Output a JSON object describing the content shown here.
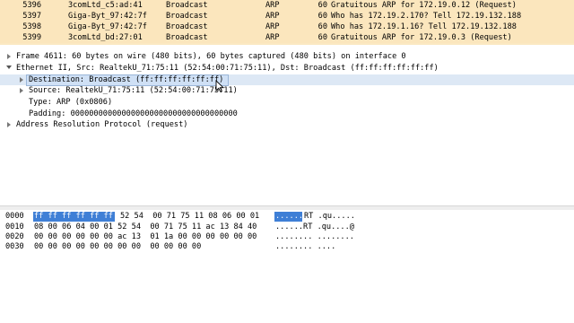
{
  "packets": [
    {
      "no": "5396",
      "src": "3comLtd_c5:ad:41",
      "dst": "Broadcast",
      "proto": "ARP",
      "len": "60",
      "info": "Gratuitous ARP for 172.19.0.12 (Request)"
    },
    {
      "no": "5397",
      "src": "Giga-Byt_97:42:7f",
      "dst": "Broadcast",
      "proto": "ARP",
      "len": "60",
      "info": "Who has 172.19.2.170? Tell 172.19.132.188"
    },
    {
      "no": "5398",
      "src": "Giga-Byt_97:42:7f",
      "dst": "Broadcast",
      "proto": "ARP",
      "len": "60",
      "info": "Who has 172.19.1.16? Tell 172.19.132.188"
    },
    {
      "no": "5399",
      "src": "3comLtd_bd:27:01",
      "dst": "Broadcast",
      "proto": "ARP",
      "len": "60",
      "info": "Gratuitous ARP for 172.19.0.3 (Request)"
    }
  ],
  "details": {
    "frame": "Frame 4611: 60 bytes on wire (480 bits), 60 bytes captured (480 bits) on interface 0",
    "ethernet": "Ethernet II, Src: RealtekU_71:75:11 (52:54:00:71:75:11), Dst: Broadcast (ff:ff:ff:ff:ff:ff)",
    "destination": "Destination: Broadcast (ff:ff:ff:ff:ff:ff)",
    "source": "Source: RealtekU_71:75:11 (52:54:00:71:75:11)",
    "type": "Type: ARP (0x0806)",
    "padding": "Padding: 000000000000000000000000000000000000",
    "arp": "Address Resolution Protocol (request)"
  },
  "bytes": {
    "rows": [
      {
        "offset": "0000",
        "hex_selected": "ff ff ff ff ff ff",
        "hex_rest": "52 54  00 71 75 11 08 06 00 01",
        "ascii_selected": "......",
        "ascii_rest": "RT .qu....."
      },
      {
        "offset": "0010",
        "hex_selected": "",
        "hex_rest": "08 00 06 04 00 01 52 54  00 71 75 11 ac 13 84 40",
        "ascii_selected": "",
        "ascii_rest": "......RT .qu....@"
      },
      {
        "offset": "0020",
        "hex_selected": "",
        "hex_rest": "00 00 00 00 00 00 ac 13  01 1a 00 00 00 00 00 00",
        "ascii_selected": "",
        "ascii_rest": "........ ........"
      },
      {
        "offset": "0030",
        "hex_selected": "",
        "hex_rest": "00 00 00 00 00 00 00 00  00 00 00 00",
        "ascii_selected": "",
        "ascii_rest": "........ ...."
      }
    ]
  },
  "colors": {
    "packet_bg": "#fbe6bd",
    "selection": "#3f7fd6",
    "highlight": "#cfe0f5"
  }
}
